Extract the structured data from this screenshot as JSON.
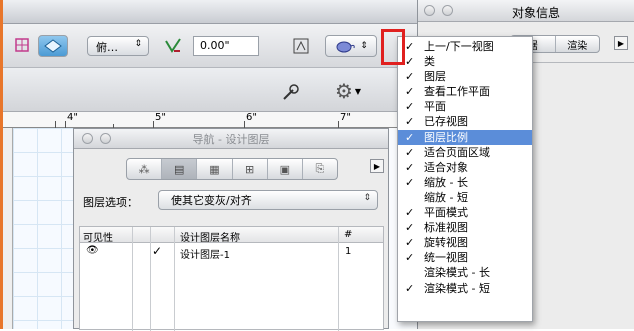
{
  "toolbar": {
    "view_dropdown": "俯…",
    "dimension_value": "0.00\""
  },
  "ruler": {
    "labels": [
      "4\"",
      "5\"",
      "6\"",
      "7\""
    ]
  },
  "navigation": {
    "title": "导航 - 设计图层",
    "layer_options_label": "图层选项：",
    "layer_options_value": "使其它变灰/对齐",
    "columns": [
      "可见性",
      "设计图层名称",
      "#"
    ],
    "rows": [
      {
        "visible_icon": "eye-icon",
        "active_check": "✓",
        "name": "设计图层-1",
        "number": "1"
      }
    ]
  },
  "info_palette": {
    "title": "对象信息",
    "tabs": [
      "据",
      "渲染"
    ]
  },
  "menu": {
    "items": [
      {
        "label": "上一/下一视图",
        "checked": "✓",
        "selected": false
      },
      {
        "label": "类",
        "checked": "✓",
        "selected": false
      },
      {
        "label": "图层",
        "checked": "✓",
        "selected": false
      },
      {
        "label": "查看工作平面",
        "checked": "✓",
        "selected": false
      },
      {
        "label": "平面",
        "checked": "✓",
        "selected": false
      },
      {
        "label": "已存视图",
        "checked": "✓",
        "selected": false
      },
      {
        "label": "图层比例",
        "checked": "✓",
        "selected": true
      },
      {
        "label": "适合页面区域",
        "checked": "✓",
        "selected": false
      },
      {
        "label": "适合对象",
        "checked": "✓",
        "selected": false
      },
      {
        "label": "缩放 - 长",
        "checked": "✓",
        "selected": false
      },
      {
        "label": "缩放 - 短",
        "checked": "",
        "selected": false
      },
      {
        "label": "平面模式",
        "checked": "✓",
        "selected": false
      },
      {
        "label": "标准视图",
        "checked": "✓",
        "selected": false
      },
      {
        "label": "旋转视图",
        "checked": "✓",
        "selected": false
      },
      {
        "label": "统一视图",
        "checked": "✓",
        "selected": false
      },
      {
        "label": "渲染模式 - 长",
        "checked": "",
        "selected": false
      },
      {
        "label": "渲染模式 - 短",
        "checked": "✓",
        "selected": false
      }
    ]
  },
  "colors": {
    "highlight": "#e0201f",
    "selection": "#5b8dd9",
    "app_frame": "#e8762b"
  }
}
